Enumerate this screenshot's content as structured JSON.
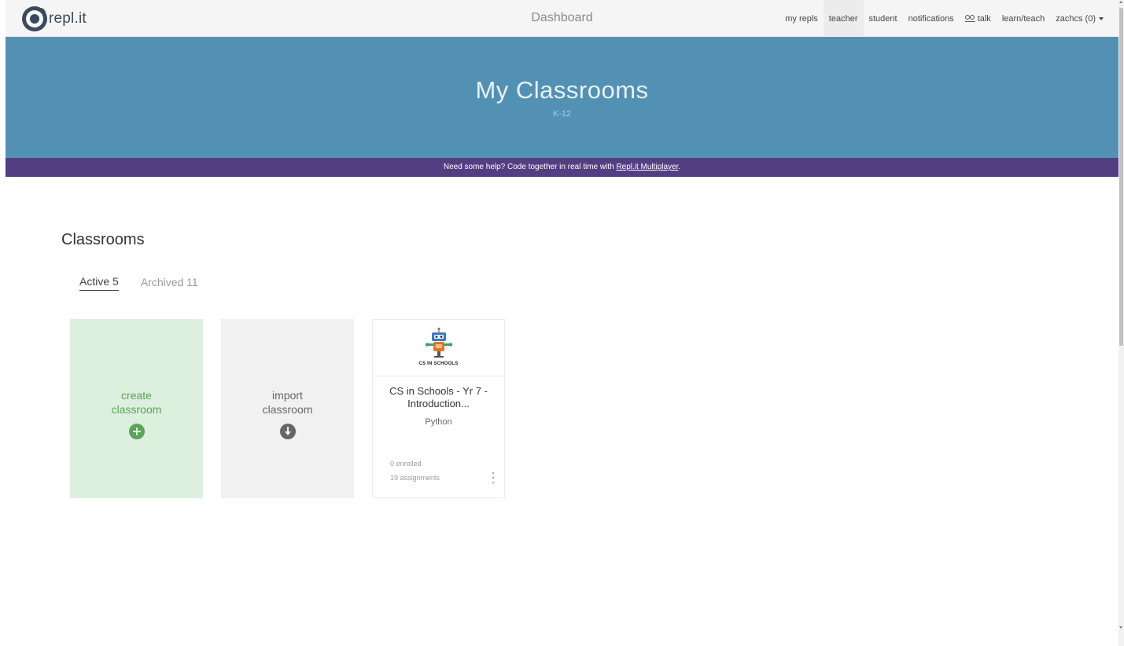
{
  "brand": {
    "name": "repl.it",
    "logo_icon": "replit-logo-icon"
  },
  "header": {
    "title": "Dashboard"
  },
  "nav": {
    "links": [
      {
        "label": "my repls"
      },
      {
        "label": "teacher",
        "active": true
      },
      {
        "label": "student"
      },
      {
        "label": "notifications"
      },
      {
        "label": "talk",
        "icon": "people-icon"
      },
      {
        "label": "learn/teach"
      },
      {
        "label": "zachcs (0)",
        "icon": "caret-down-icon"
      }
    ]
  },
  "hero": {
    "title": "My Classrooms",
    "subtitle": "K-12",
    "background": "#5391b4"
  },
  "banner": {
    "text": "Need some help? Code together in real time with ",
    "link_label": "Repl.it Multiplayer",
    "suffix": ".",
    "background": "#543e82"
  },
  "main": {
    "section_title": "Classrooms",
    "tabs": [
      {
        "label": "Active 5",
        "active": true
      },
      {
        "label": "Archived 11",
        "active": false
      }
    ],
    "create_card": {
      "line1": "create",
      "line2": "classroom",
      "icon": "plus-circle-icon",
      "color": "#5aa35a"
    },
    "import_card": {
      "line1": "import",
      "line2": "classroom",
      "icon": "download-circle-icon"
    },
    "classrooms": [
      {
        "name": "CS in Schools - Yr 7 - Introduction...",
        "language": "Python",
        "thumbnail_caption": "CS IN SCHOOLS",
        "enrolled": "0 enrolled",
        "assignments": "19 assignments"
      }
    ]
  }
}
